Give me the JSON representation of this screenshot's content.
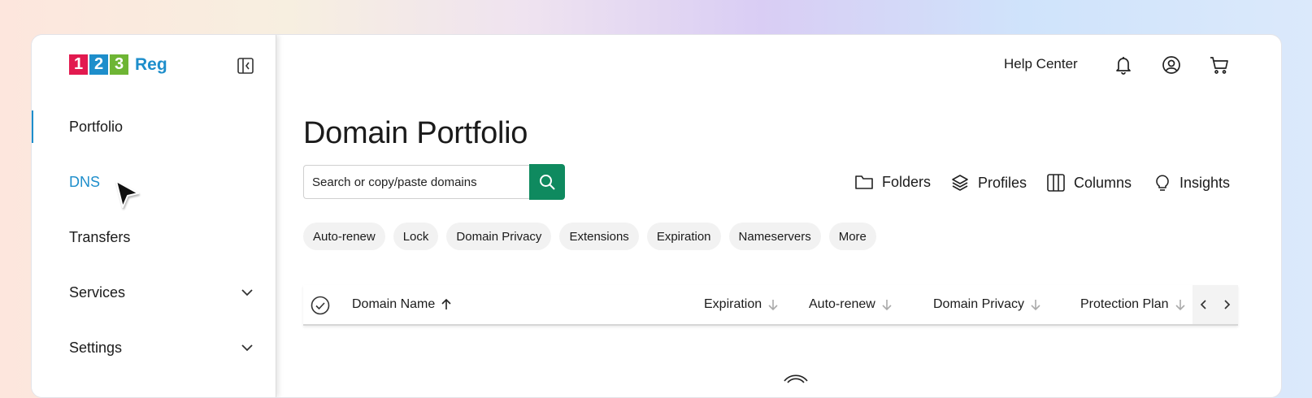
{
  "brand": {
    "logo_digits": [
      "1",
      "2",
      "3"
    ],
    "logo_word": "Reg",
    "digit_colors": [
      "#e21a4f",
      "#1e8ecb",
      "#6eb534"
    ],
    "accent": "#1e8ecb",
    "search_button_color": "#0f8a5f"
  },
  "sidebar": {
    "items": [
      {
        "label": "Portfolio"
      },
      {
        "label": "DNS"
      },
      {
        "label": "Transfers"
      },
      {
        "label": "Services"
      },
      {
        "label": "Settings"
      }
    ]
  },
  "header": {
    "help_label": "Help Center",
    "icons": [
      "bell-icon",
      "user-icon",
      "cart-icon"
    ]
  },
  "main": {
    "title": "Domain Portfolio",
    "search_placeholder": "Search or copy/paste domains",
    "tools": [
      "Folders",
      "Profiles",
      "Columns",
      "Insights"
    ],
    "filters": [
      "Auto-renew",
      "Lock",
      "Domain Privacy",
      "Extensions",
      "Expiration",
      "Nameservers",
      "More"
    ],
    "columns": [
      "Domain Name",
      "Expiration",
      "Auto-renew",
      "Domain Privacy",
      "Protection Plan"
    ]
  }
}
